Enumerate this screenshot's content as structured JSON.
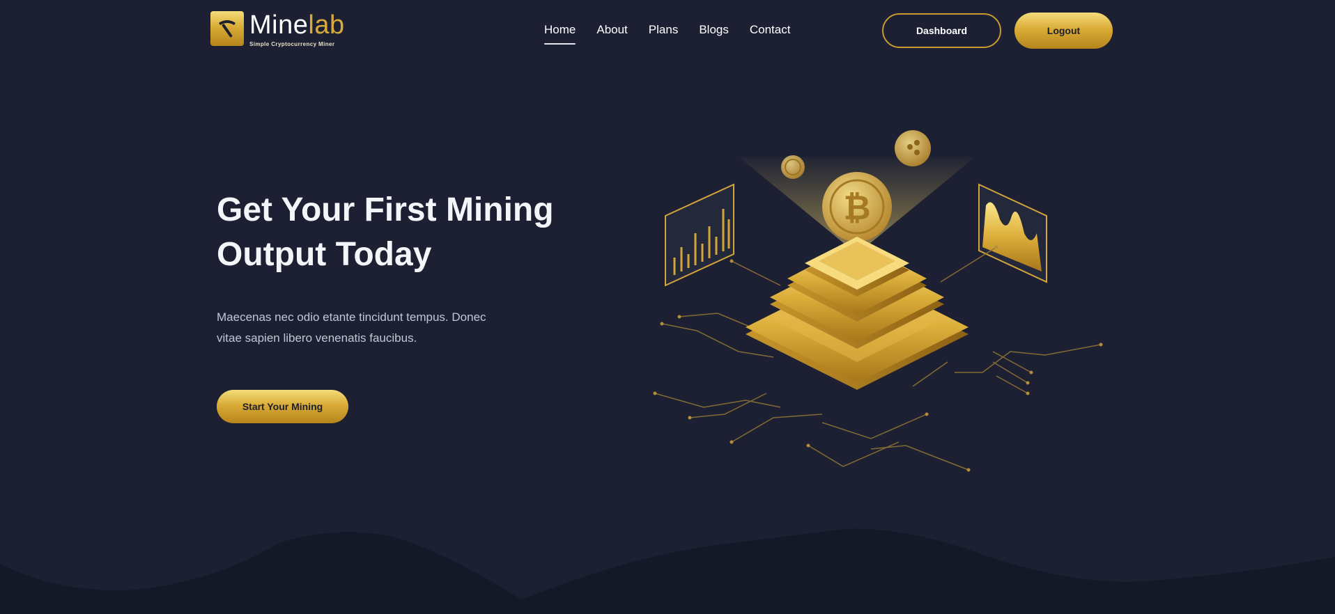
{
  "brand": {
    "name_part1": "Mine",
    "name_part2": "lab",
    "tagline": "Simple Cryptocurrency Miner",
    "logo_icon": "pickaxe-icon"
  },
  "nav": {
    "items": [
      {
        "label": "Home",
        "active": true
      },
      {
        "label": "About",
        "active": false
      },
      {
        "label": "Plans",
        "active": false
      },
      {
        "label": "Blogs",
        "active": false
      },
      {
        "label": "Contact",
        "active": false
      }
    ]
  },
  "header_actions": {
    "dashboard_label": "Dashboard",
    "logout_label": "Logout"
  },
  "hero": {
    "title_line1": "Get Your First Mining",
    "title_line2": "Output Today",
    "desc_line1": "Maecenas nec odio etante tincidunt tempus. Donec",
    "desc_line2": "vitae sapien libero venenatis faucibus.",
    "cta_label": "Start Your Mining"
  },
  "illustration": {
    "icon": "bitcoin-mining-icon",
    "coin_symbol": "₿"
  },
  "colors": {
    "background": "#1c2032",
    "accent_gold": "#d7a934",
    "wave_dark": "#141826"
  }
}
